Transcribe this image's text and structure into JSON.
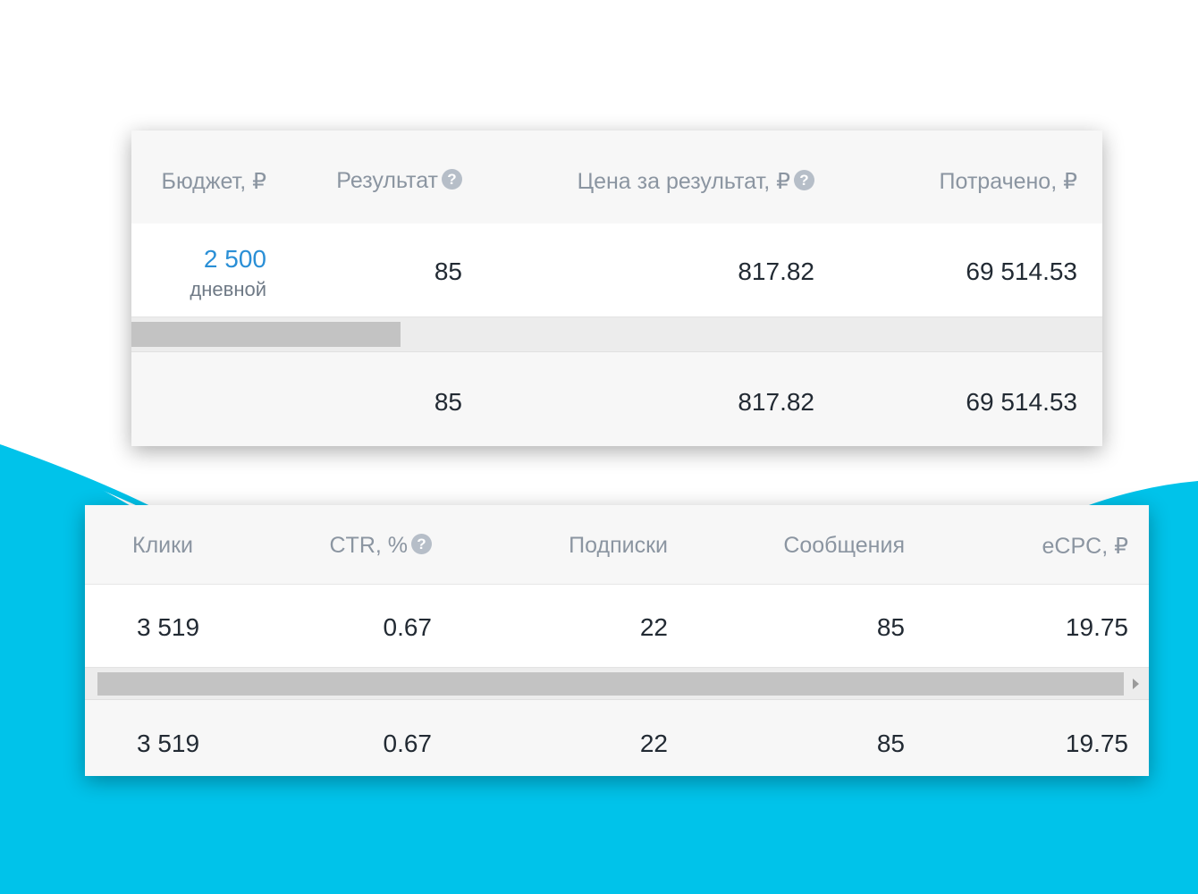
{
  "colors": {
    "background_wave": "#00c3ea",
    "panel_header_bg": "#f7f7f7",
    "link_blue": "#2a8fd6",
    "header_text": "#8b95a1",
    "value_text": "#222a33"
  },
  "top_table": {
    "headers": {
      "budget": "Бюджет, ₽",
      "result": "Результат",
      "price_per_result": "Цена за результат, ₽",
      "spent": "Потрачено, ₽"
    },
    "help_icon_glyph": "?",
    "row": {
      "budget_value": "2 500",
      "budget_type": "дневной",
      "result": "85",
      "price_per_result": "817.82",
      "spent": "69 514.53"
    },
    "total": {
      "result": "85",
      "price_per_result": "817.82",
      "spent": "69 514.53"
    }
  },
  "bottom_table": {
    "headers": {
      "clicks": "Клики",
      "ctr": "CTR, %",
      "subscriptions": "Подписки",
      "messages": "Сообщения",
      "ecpc": "eCPC, ₽"
    },
    "help_icon_glyph": "?",
    "row": {
      "clicks": "3 519",
      "ctr": "0.67",
      "subscriptions": "22",
      "messages": "85",
      "ecpc": "19.75"
    },
    "total": {
      "clicks": "3 519",
      "ctr": "0.67",
      "subscriptions": "22",
      "messages": "85",
      "ecpc": "19.75"
    }
  }
}
